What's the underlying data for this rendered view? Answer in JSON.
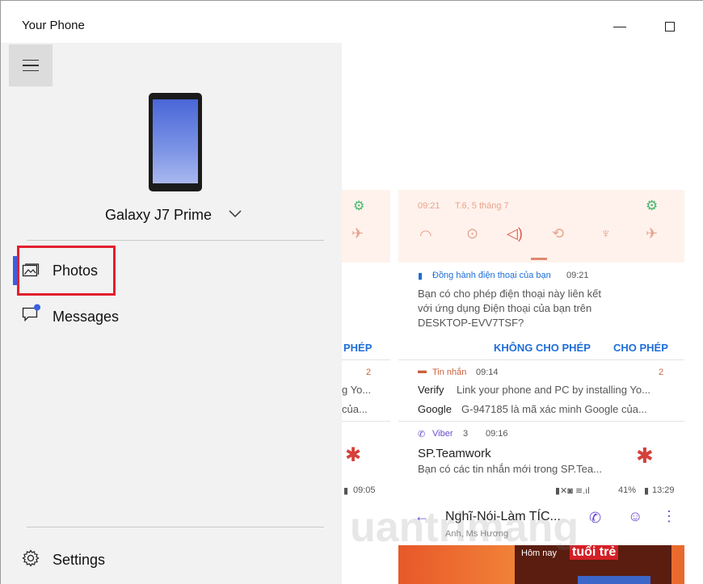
{
  "window": {
    "title": "Your Phone"
  },
  "sidebar": {
    "device_name": "Galaxy J7 Prime",
    "items": [
      {
        "label": "Photos",
        "icon": "photos-icon"
      },
      {
        "label": "Messages",
        "icon": "messages-icon"
      }
    ],
    "settings_label": "Settings"
  },
  "phone_screen": {
    "time": "09:21",
    "date": "T.6, 5 tháng 7",
    "notification_app": "Đồng hành điện thoại của bạn",
    "notification_time": "09:21",
    "notification_body_1": "Bạn có cho phép điện thoại này liên kết",
    "notification_body_2": "với ứng dụng Điện thoại của bạn trên",
    "notification_body_3": "DESKTOP-EVV7TSF?",
    "deny_button": "KHÔNG CHO PHÉP",
    "allow_button": "CHO PHÉP",
    "allow_button_clipped": "PHÉP",
    "msg_app": "Tin nhắn",
    "msg_time": "09:14",
    "msg_count": "2",
    "msg1_sender": "Verify",
    "msg1_text": "Link your phone and PC by installing Yo...",
    "msg2_sender": "Google",
    "msg2_text": "G-947185 là mã xác minh Google của...",
    "clipped_line1": "g Yo...",
    "clipped_line2": "của...",
    "viber_app": "Viber",
    "viber_count": "3",
    "viber_time": "09:16",
    "viber_title": "SP.Teamwork",
    "viber_text": "Bạn có các tin nhắn mới trong SP.Tea...",
    "status_left_time": "09:05",
    "status_right": "41%",
    "status_right_time": "13:29",
    "chat_title": "Nghĩ-Nói-Làm TÍC...",
    "chat_subtitle": "Anh, Ms Hương",
    "banner_text": "Hôm nay",
    "banner_brand": "tuổi trẻ",
    "watermark": "uantrimang"
  }
}
